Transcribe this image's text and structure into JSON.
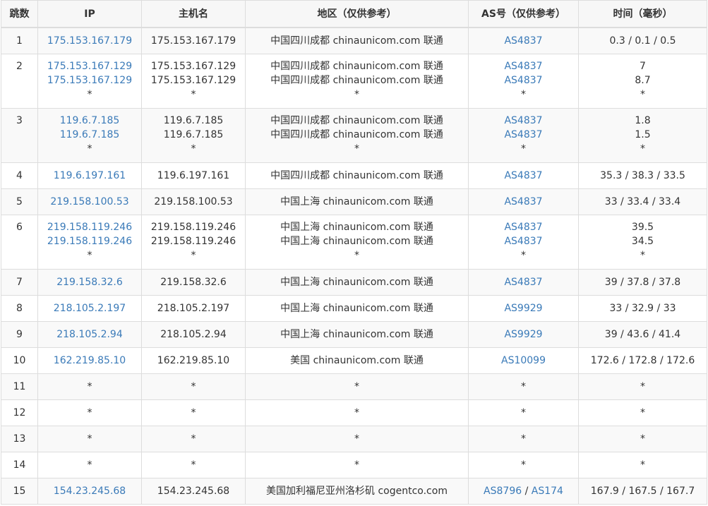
{
  "headers": {
    "hop": "跳数",
    "ip": "IP",
    "host": "主机名",
    "region": "地区（仅供参考）",
    "asn": "AS号（仅供参考）",
    "time": "时间（毫秒）"
  },
  "rows": [
    {
      "hop": "1",
      "lines": [
        {
          "ip": "175.153.167.179",
          "host": "175.153.167.179",
          "region": "中国四川成都 chinaunicom.com 联通",
          "asn": [
            "AS4837"
          ],
          "time": "0.3 / 0.1 / 0.5"
        }
      ]
    },
    {
      "hop": "2",
      "lines": [
        {
          "ip": "175.153.167.129",
          "host": "175.153.167.129",
          "region": "中国四川成都 chinaunicom.com 联通",
          "asn": [
            "AS4837"
          ],
          "time": "7"
        },
        {
          "ip": "175.153.167.129",
          "host": "175.153.167.129",
          "region": "中国四川成都 chinaunicom.com 联通",
          "asn": [
            "AS4837"
          ],
          "time": "8.7"
        },
        {
          "ip": "*",
          "host": "*",
          "region": "*",
          "asn": [
            "*"
          ],
          "time": "*"
        }
      ]
    },
    {
      "hop": "3",
      "lines": [
        {
          "ip": "119.6.7.185",
          "host": "119.6.7.185",
          "region": "中国四川成都 chinaunicom.com 联通",
          "asn": [
            "AS4837"
          ],
          "time": "1.8"
        },
        {
          "ip": "119.6.7.185",
          "host": "119.6.7.185",
          "region": "中国四川成都 chinaunicom.com 联通",
          "asn": [
            "AS4837"
          ],
          "time": "1.5"
        },
        {
          "ip": "*",
          "host": "*",
          "region": "*",
          "asn": [
            "*"
          ],
          "time": "*"
        }
      ]
    },
    {
      "hop": "4",
      "lines": [
        {
          "ip": "119.6.197.161",
          "host": "119.6.197.161",
          "region": "中国四川成都 chinaunicom.com 联通",
          "asn": [
            "AS4837"
          ],
          "time": "35.3 / 38.3 / 33.5"
        }
      ]
    },
    {
      "hop": "5",
      "lines": [
        {
          "ip": "219.158.100.53",
          "host": "219.158.100.53",
          "region": "中国上海 chinaunicom.com 联通",
          "asn": [
            "AS4837"
          ],
          "time": "33 / 33.4 / 33.4"
        }
      ]
    },
    {
      "hop": "6",
      "lines": [
        {
          "ip": "219.158.119.246",
          "host": "219.158.119.246",
          "region": "中国上海 chinaunicom.com 联通",
          "asn": [
            "AS4837"
          ],
          "time": "39.5"
        },
        {
          "ip": "219.158.119.246",
          "host": "219.158.119.246",
          "region": "中国上海 chinaunicom.com 联通",
          "asn": [
            "AS4837"
          ],
          "time": "34.5"
        },
        {
          "ip": "*",
          "host": "*",
          "region": "*",
          "asn": [
            "*"
          ],
          "time": "*"
        }
      ]
    },
    {
      "hop": "7",
      "lines": [
        {
          "ip": "219.158.32.6",
          "host": "219.158.32.6",
          "region": "中国上海 chinaunicom.com 联通",
          "asn": [
            "AS4837"
          ],
          "time": "39 / 37.8 / 37.8"
        }
      ]
    },
    {
      "hop": "8",
      "lines": [
        {
          "ip": "218.105.2.197",
          "host": "218.105.2.197",
          "region": "中国上海 chinaunicom.com 联通",
          "asn": [
            "AS9929"
          ],
          "time": "33 / 32.9 / 33"
        }
      ]
    },
    {
      "hop": "9",
      "lines": [
        {
          "ip": "218.105.2.94",
          "host": "218.105.2.94",
          "region": "中国上海 chinaunicom.com 联通",
          "asn": [
            "AS9929"
          ],
          "time": "39 / 43.6 / 41.4"
        }
      ]
    },
    {
      "hop": "10",
      "lines": [
        {
          "ip": "162.219.85.10",
          "host": "162.219.85.10",
          "region": "美国 chinaunicom.com 联通",
          "asn": [
            "AS10099"
          ],
          "time": "172.6 / 172.8 / 172.6"
        }
      ]
    },
    {
      "hop": "11",
      "lines": [
        {
          "ip": "*",
          "host": "*",
          "region": "*",
          "asn": [
            "*"
          ],
          "time": "*"
        }
      ]
    },
    {
      "hop": "12",
      "lines": [
        {
          "ip": "*",
          "host": "*",
          "region": "*",
          "asn": [
            "*"
          ],
          "time": "*"
        }
      ]
    },
    {
      "hop": "13",
      "lines": [
        {
          "ip": "*",
          "host": "*",
          "region": "*",
          "asn": [
            "*"
          ],
          "time": "*"
        }
      ]
    },
    {
      "hop": "14",
      "lines": [
        {
          "ip": "*",
          "host": "*",
          "region": "*",
          "asn": [
            "*"
          ],
          "time": "*"
        }
      ]
    },
    {
      "hop": "15",
      "lines": [
        {
          "ip": "154.23.245.68",
          "host": "154.23.245.68",
          "region": "美国加利福尼亚州洛杉矶 cogentco.com",
          "asn": [
            "AS8796",
            "AS174"
          ],
          "time": "167.9 / 167.5 / 167.7"
        }
      ]
    }
  ],
  "asn_separator": " / ",
  "colors": {
    "link": "#3a7ab8",
    "text": "#333333",
    "border": "#dddddd",
    "row_alt": "#f9f9f9"
  }
}
